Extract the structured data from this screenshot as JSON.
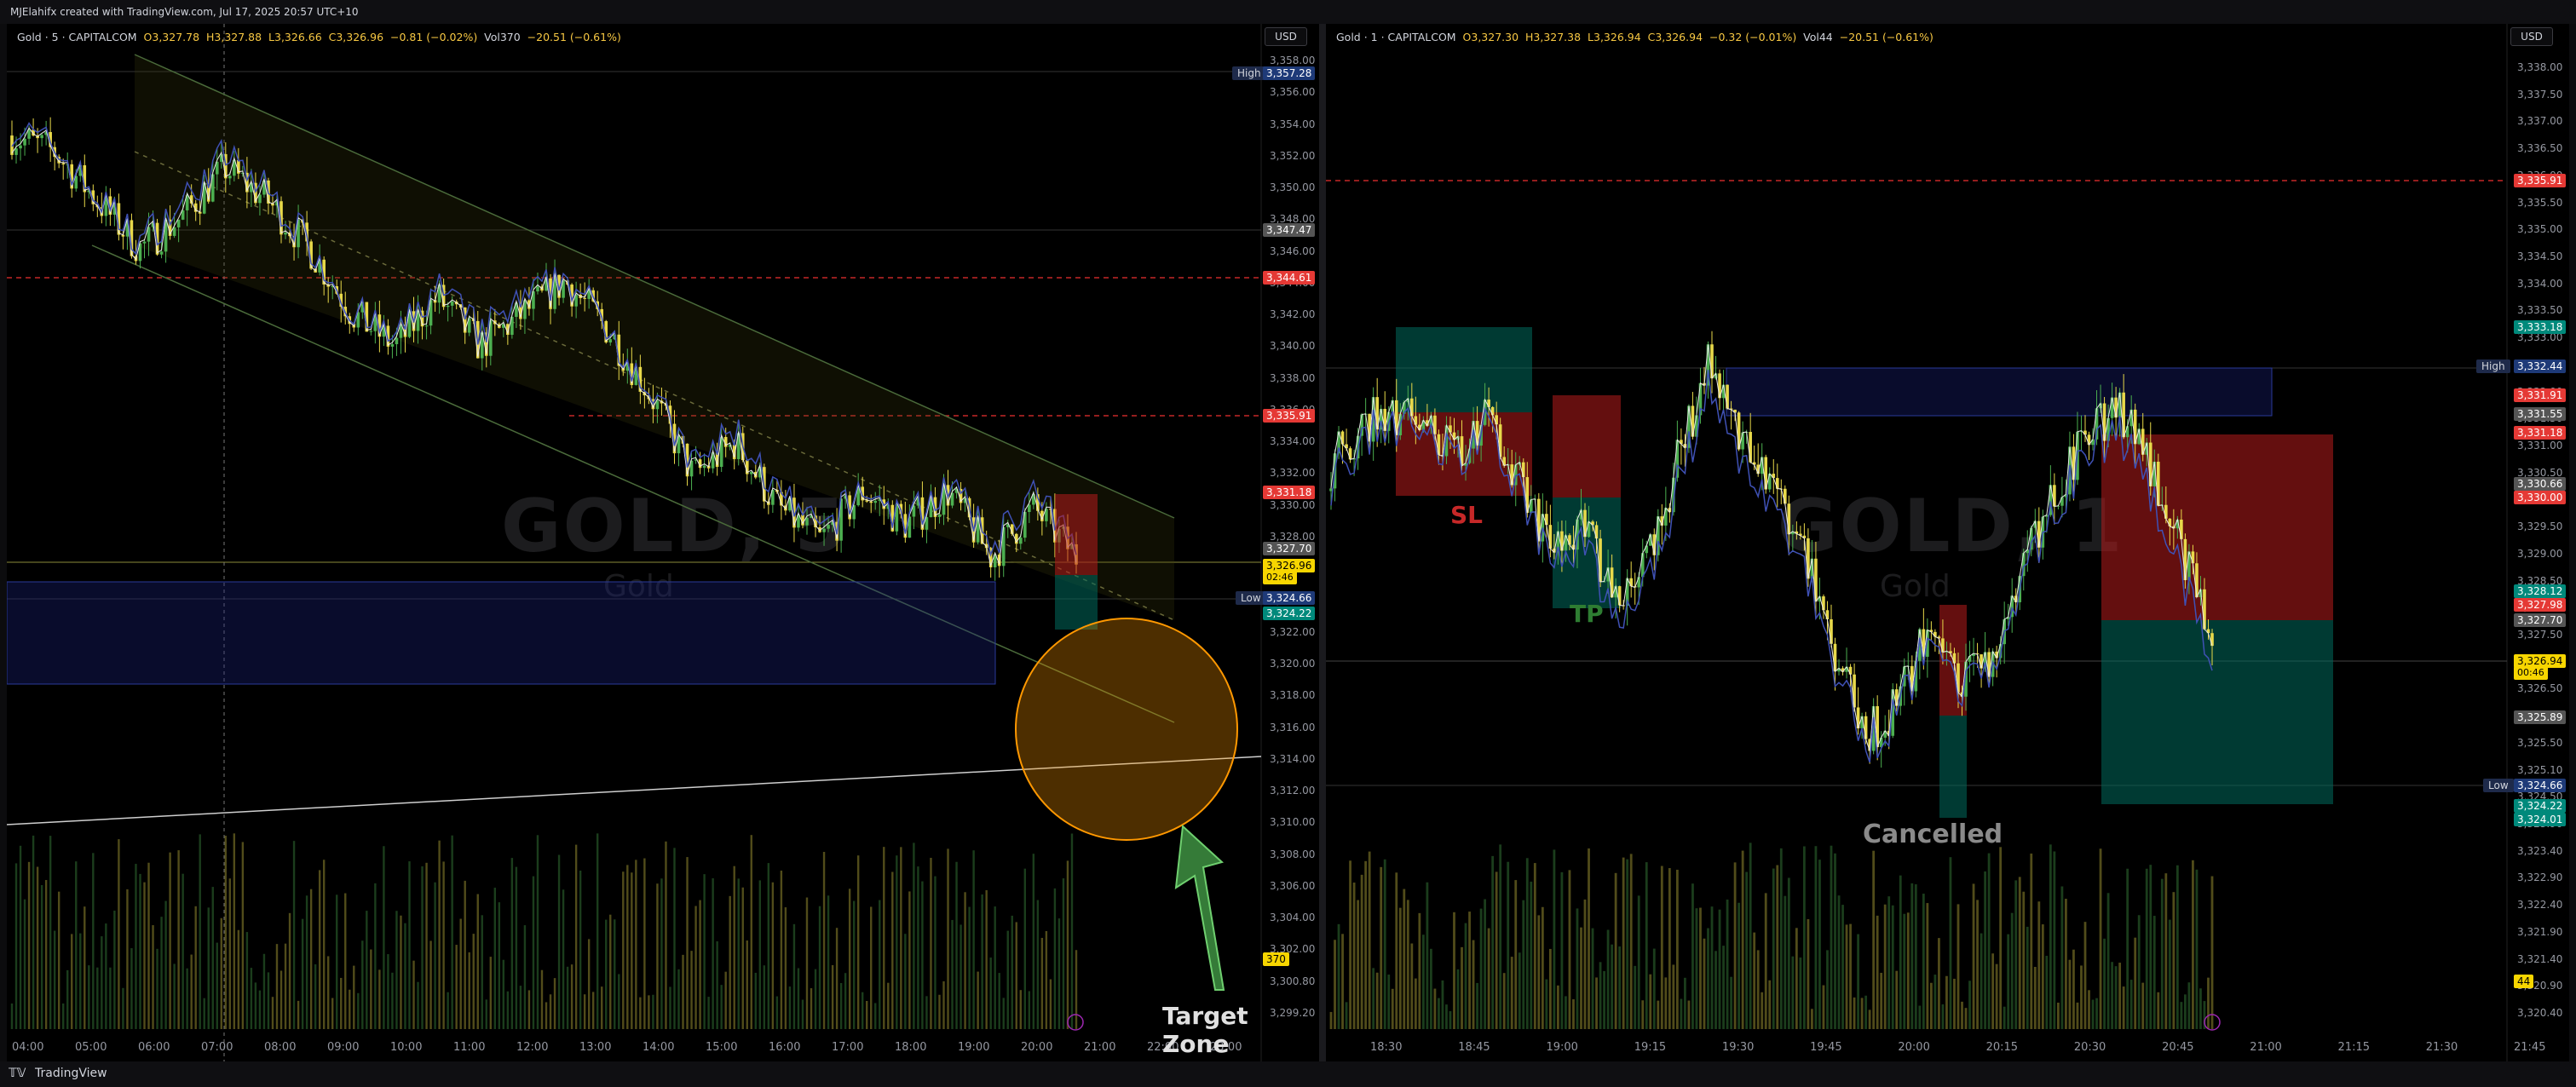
{
  "header": {
    "credit": "MJElahifx created with TradingView.com, Jul 17, 2025 20:57 UTC+10"
  },
  "footer": {
    "brand": "TradingView"
  },
  "colors": {
    "up": "#4caf50",
    "down": "#e8d94a",
    "sl": "#b71c1c",
    "tp": "#00695c",
    "zone": "#1a237e",
    "accent": "#ff9800"
  },
  "left": {
    "legend": {
      "symbol": "Gold · 5 · CAPITALCOM",
      "o": "O3,327.78",
      "h": "H3,327.88",
      "l": "L3,326.66",
      "c": "C3,326.96",
      "chg": "−0.81 (−0.02%)",
      "vol": "Vol370",
      "vchg": "−20.51 (−0.61%)"
    },
    "currency": "USD",
    "watermark": "GOLD, 5",
    "watermark_sub": "Gold",
    "price_ticks": [
      "3,358.00",
      "3,356.00",
      "3,354.00",
      "3,352.00",
      "3,350.00",
      "3,348.00",
      "3,346.00",
      "3,344.00",
      "3,342.00",
      "3,340.00",
      "3,338.00",
      "3,336.00",
      "3,334.00",
      "3,332.00",
      "3,330.00",
      "3,328.00",
      "3,326.00",
      "3,324.00",
      "3,322.00",
      "3,320.00",
      "3,318.00",
      "3,316.00",
      "3,314.00",
      "3,312.00",
      "3,310.00",
      "3,308.00",
      "3,306.00",
      "3,304.00",
      "3,302.00",
      "3,300.80",
      "3,299.20"
    ],
    "time_ticks": [
      "04:00",
      "05:00",
      "06:00",
      "07:00",
      "08:00",
      "09:00",
      "10:00",
      "11:00",
      "12:00",
      "13:00",
      "14:00",
      "15:00",
      "16:00",
      "17:00",
      "18:00",
      "19:00",
      "20:00",
      "21:00",
      "22:00",
      "23:00"
    ],
    "tags": {
      "high_label": "High",
      "high": "3,357.28",
      "p1": "3,347.47",
      "p2": "3,344.61",
      "p3": "3,335.91",
      "p4": "3,331.18",
      "p5": "3,327.70",
      "last": "3,326.96",
      "countdown": "02:46",
      "low_label": "Low",
      "low": "3,324.66",
      "p6": "3,324.22",
      "vol": "370"
    },
    "annotation": "Target Zone"
  },
  "right": {
    "legend": {
      "symbol": "Gold · 1 · CAPITALCOM",
      "o": "O3,327.30",
      "h": "H3,327.38",
      "l": "L3,326.94",
      "c": "C3,326.94",
      "chg": "−0.32 (−0.01%)",
      "vol": "Vol44",
      "vchg": "−20.51 (−0.61%)"
    },
    "currency": "USD",
    "watermark": "GOLD, 1",
    "watermark_sub": "Gold",
    "price_ticks": [
      "3,338.00",
      "3,337.50",
      "3,337.00",
      "3,336.50",
      "3,336.00",
      "3,335.50",
      "3,335.00",
      "3,334.50",
      "3,334.00",
      "3,333.50",
      "3,333.00",
      "3,332.50",
      "3,332.00",
      "3,331.50",
      "3,331.00",
      "3,330.50",
      "3,330.00",
      "3,329.50",
      "3,329.00",
      "3,328.50",
      "3,328.00",
      "3,327.50",
      "3,327.00",
      "3,326.50",
      "3,326.00",
      "3,325.50",
      "3,325.10",
      "3,324.50",
      "3,323.90",
      "3,323.40",
      "3,322.90",
      "3,322.40",
      "3,321.90",
      "3,321.40",
      "3,320.90",
      "3,320.40"
    ],
    "time_ticks": [
      "18:30",
      "18:45",
      "19:00",
      "19:15",
      "19:30",
      "19:45",
      "20:00",
      "20:15",
      "20:30",
      "20:45",
      "21:00",
      "21:15",
      "21:30",
      "21:45"
    ],
    "tags": {
      "p1": "3,335.91",
      "p2": "3,333.18",
      "high_label": "High",
      "high": "3,332.44",
      "p3": "3,331.91",
      "p4": "3,331.55",
      "p5": "3,331.18",
      "p6": "3,330.66",
      "p7": "3,330.00",
      "p8": "3,328.12",
      "p9": "3,327.98",
      "p10": "3,327.70",
      "last": "3,326.94",
      "countdown": "00:46",
      "p11": "3,325.89",
      "low_label": "Low",
      "low": "3,324.66",
      "p12": "3,324.22",
      "p13": "3,324.01",
      "vol": "44"
    },
    "annotations": {
      "sl": "SL",
      "tp": "TP",
      "cancelled": "Cancelled"
    }
  }
}
